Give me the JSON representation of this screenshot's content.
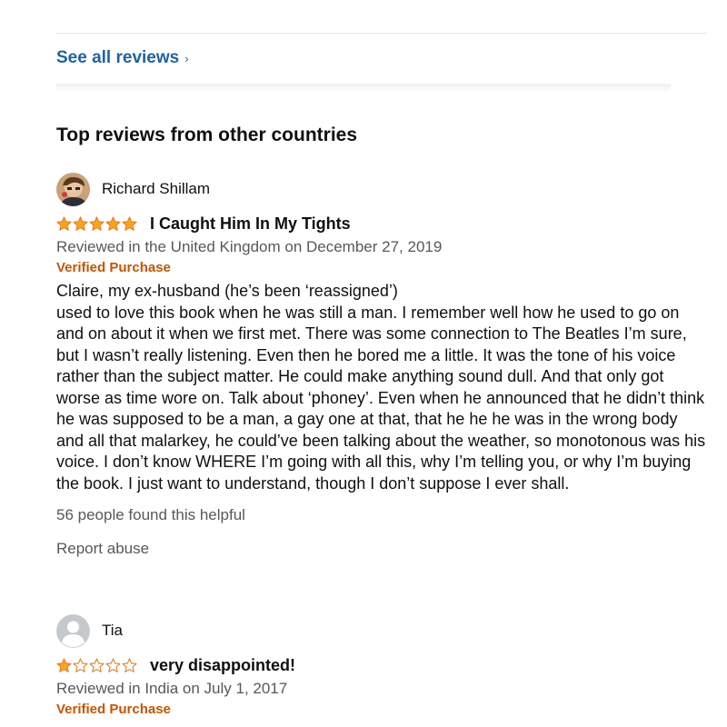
{
  "see_all": {
    "label": "See all reviews",
    "chevron": "›"
  },
  "section_heading": "Top reviews from other countries",
  "reviews": [
    {
      "profile_name": "Richard Shillam",
      "avatar_icon": "profile-photo-avatar",
      "rating": 5,
      "rating_max": 5,
      "title": "I Caught Him In My Tights",
      "date": "Reviewed in the United Kingdom on December 27, 2019",
      "verified": "Verified Purchase",
      "body": [
        "Claire, my ex-husband (he’s been ‘reassigned’)",
        "used to love this book when he was still a man. I remember well how he used to go on and on about it when we first met. There was some connection to The Beatles I’m sure, but I wasn’t really listening. Even then he bored me a little. It was the tone of his voice rather than the subject matter. He could make anything sound dull. And that only got worse as time wore on. Talk about ‘phoney’. Even when he announced that he didn’t think he was supposed to be a man, a gay one at that, that he he he was in the wrong body and all that malarkey, he could’ve been talking about the weather, so monotonous was his voice. I don’t know WHERE I’m going with all this, why I’m telling you, or why I’m buying the book. I just want to understand, though I don’t suppose I ever shall."
      ],
      "helpful": "56 people found this helpful",
      "report": "Report abuse"
    },
    {
      "profile_name": "Tia",
      "avatar_icon": "default-user-avatar-icon",
      "rating": 1,
      "rating_max": 5,
      "title": "very disappointed!",
      "date": "Reviewed in India on July 1, 2017",
      "verified": "Verified Purchase"
    }
  ],
  "colors": {
    "link": "#2162a1",
    "star": "#ffa41c",
    "verified": "#c45500",
    "muted": "#565959"
  }
}
